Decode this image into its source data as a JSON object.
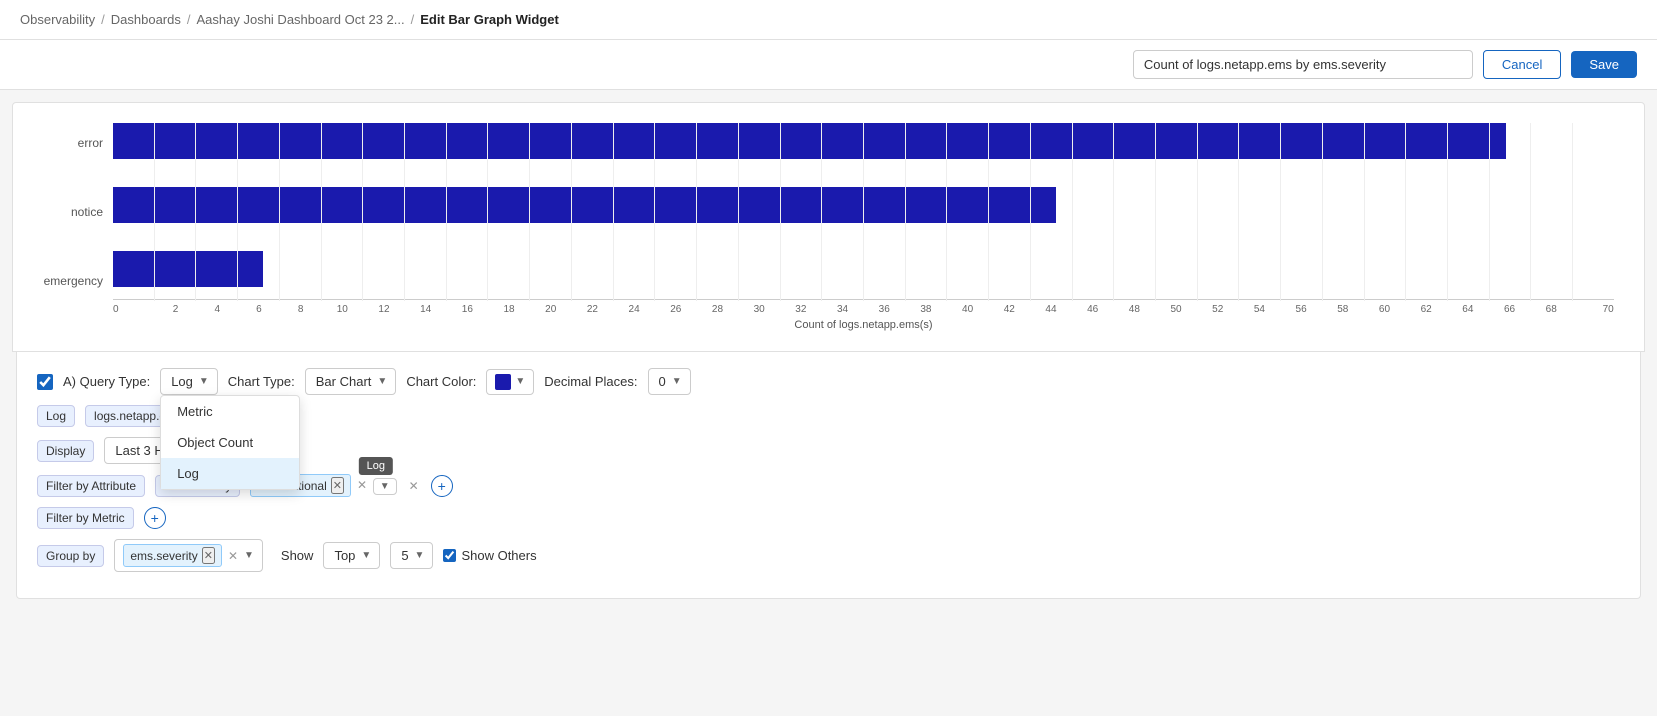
{
  "breadcrumb": {
    "items": [
      "Observability",
      "Dashboards",
      "Aashay Joshi Dashboard Oct 23 2...",
      "Edit Bar Graph Widget"
    ]
  },
  "header": {
    "widget_title": "Count of logs.netapp.ems by ems.severity",
    "cancel_label": "Cancel",
    "save_label": "Save"
  },
  "chart": {
    "bars": [
      {
        "label": "error",
        "value": 65,
        "max": 70
      },
      {
        "label": "notice",
        "value": 44,
        "max": 70
      },
      {
        "label": "emergency",
        "value": 7,
        "max": 70
      }
    ],
    "x_axis_label": "Count of logs.netapp.ems(s)",
    "x_ticks": [
      "0",
      "2",
      "4",
      "6",
      "8",
      "10",
      "12",
      "14",
      "16",
      "18",
      "20",
      "22",
      "24",
      "26",
      "28",
      "30",
      "32",
      "34",
      "36",
      "38",
      "40",
      "42",
      "44",
      "46",
      "48",
      "50",
      "52",
      "54",
      "56",
      "58",
      "60",
      "62",
      "64",
      "66",
      "68",
      "70"
    ]
  },
  "config": {
    "query_type_label": "A) Query Type:",
    "query_type_selected": "Log",
    "query_type_options": [
      "Metric",
      "Object Count",
      "Log"
    ],
    "chart_type_label": "Chart Type:",
    "chart_type_selected": "Bar Chart",
    "chart_color_label": "Chart Color:",
    "decimal_places_label": "Decimal Places:",
    "decimal_places_value": "0",
    "log_label": "Log",
    "datasource_label": "logs.netapp.ems",
    "display_label": "Display",
    "display_value": "Last 3 Hours",
    "filter_attribute_label": "Filter by Attribute",
    "filter_attribute_field": "ems.severity",
    "filter_attribute_value": "Informational",
    "filter_metric_label": "Filter by Metric",
    "group_by_label": "Group by",
    "group_by_field": "ems.severity",
    "show_label": "Show",
    "top_label": "Top",
    "top_value": "5",
    "show_others_label": "Show Others",
    "tooltip_text": "Log"
  }
}
